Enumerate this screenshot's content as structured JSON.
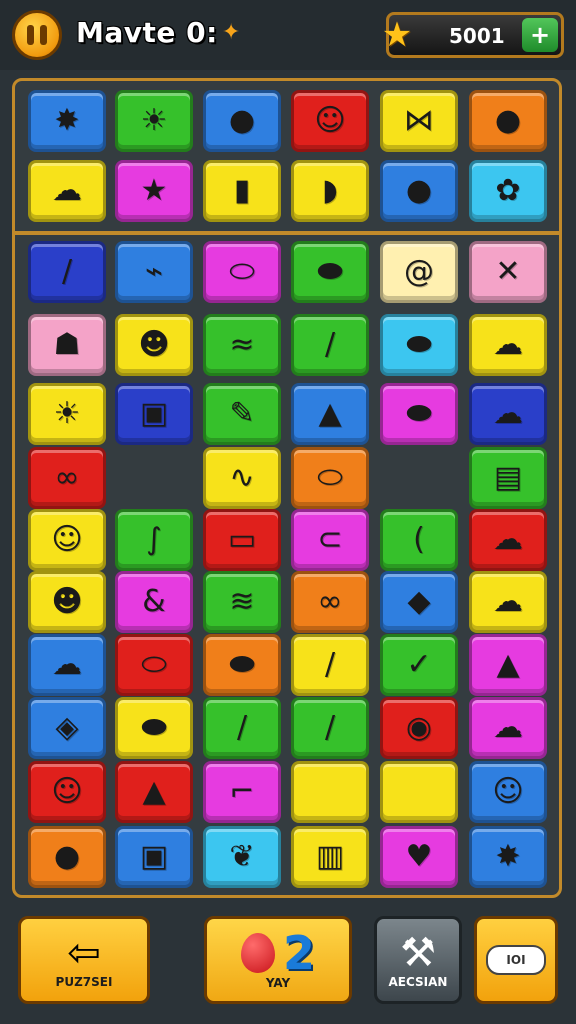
{
  "header": {
    "title": "Mavte 0:",
    "score": "5001",
    "add_symbol": "+"
  },
  "board": {
    "colors": {
      "blue": "#2f7fe0",
      "green": "#36c12b",
      "red": "#e0201c",
      "yellow": "#f7e21a",
      "orange": "#f07f1a",
      "magenta": "#e63be0",
      "navy": "#2a3fc9",
      "cyan": "#3cc6f0",
      "pink": "#f4a3c8",
      "lightyellow": "#fff0b0"
    },
    "rows": [
      [
        {
          "c": "blue",
          "i": "badge-icon",
          "g": "✸"
        },
        {
          "c": "green",
          "i": "sun-icon",
          "g": "☀"
        },
        {
          "c": "blue",
          "i": "apple-icon",
          "g": "●"
        },
        {
          "c": "red",
          "i": "bear-face-icon",
          "g": "☺"
        },
        {
          "c": "yellow",
          "i": "bow-icon",
          "g": "⋈"
        },
        {
          "c": "orange",
          "i": "drop-icon",
          "g": "●"
        }
      ],
      [
        {
          "c": "yellow",
          "i": "cookie-icon",
          "g": "☁"
        },
        {
          "c": "magenta",
          "i": "star-face-icon",
          "g": "★"
        },
        {
          "c": "yellow",
          "i": "bottle-icon",
          "g": "▮"
        },
        {
          "c": "yellow",
          "i": "boat-icon",
          "g": "◗"
        },
        {
          "c": "blue",
          "i": "creature-icon",
          "g": "●"
        },
        {
          "c": "cyan",
          "i": "berry-icon",
          "g": "✿"
        }
      ],
      [
        {
          "c": "navy",
          "i": "stick-icon",
          "g": "/"
        },
        {
          "c": "blue",
          "i": "carrot-icon",
          "g": "⌁"
        },
        {
          "c": "magenta",
          "i": "bean-icon",
          "g": "⬭"
        },
        {
          "c": "green",
          "i": "eggplant-icon",
          "g": "⬬"
        },
        {
          "c": "lightyellow",
          "i": "shrimp-icon",
          "g": "@"
        },
        {
          "c": "pink",
          "i": "tools-icon",
          "g": "✕"
        }
      ],
      [
        {
          "c": "pink",
          "i": "bottle-blue-icon",
          "g": "☗"
        },
        {
          "c": "yellow",
          "i": "chick-icon",
          "g": "☻"
        },
        {
          "c": "green",
          "i": "bacon-icon",
          "g": "≈"
        },
        {
          "c": "green",
          "i": "knife-icon",
          "g": "/"
        },
        {
          "c": "cyan",
          "i": "bun-icon",
          "g": "⬬"
        },
        {
          "c": "yellow",
          "i": "cloud-icon",
          "g": "☁"
        }
      ],
      [
        {
          "c": "yellow",
          "i": "sun-face-icon",
          "g": "☀"
        },
        {
          "c": "navy",
          "i": "bag-icon",
          "g": "▣"
        },
        {
          "c": "green",
          "i": "pen-icon",
          "g": "✎"
        },
        {
          "c": "blue",
          "i": "mountain-icon",
          "g": "▲"
        },
        {
          "c": "magenta",
          "i": "cushion-icon",
          "g": "⬬"
        },
        {
          "c": "navy",
          "i": "cookie-icon",
          "g": "☁"
        }
      ],
      [
        {
          "c": "red",
          "i": "knot-icon",
          "g": "∞"
        },
        null,
        {
          "c": "yellow",
          "i": "squiggle-icon",
          "g": "∿"
        },
        {
          "c": "orange",
          "i": "capsule-icon",
          "g": "⬭"
        },
        null,
        {
          "c": "green",
          "i": "radio-icon",
          "g": "▤"
        }
      ],
      [
        {
          "c": "yellow",
          "i": "smile-icon",
          "g": "☺"
        },
        {
          "c": "green",
          "i": "worm-icon",
          "g": "∫"
        },
        {
          "c": "red",
          "i": "biscuit-icon",
          "g": "▭"
        },
        {
          "c": "magenta",
          "i": "clip-icon",
          "g": "⊂"
        },
        {
          "c": "green",
          "i": "leaf-icon",
          "g": "("
        },
        {
          "c": "red",
          "i": "cloud-icon",
          "g": "☁"
        }
      ],
      [
        {
          "c": "yellow",
          "i": "face-icon",
          "g": "☻"
        },
        {
          "c": "magenta",
          "i": "pretzel-icon",
          "g": "&"
        },
        {
          "c": "green",
          "i": "zigzag-icon",
          "g": "≋"
        },
        {
          "c": "orange",
          "i": "knot-icon",
          "g": "∞"
        },
        {
          "c": "blue",
          "i": "fish-icon",
          "g": "◆"
        },
        {
          "c": "yellow",
          "i": "cloud-icon",
          "g": "☁"
        }
      ],
      [
        {
          "c": "blue",
          "i": "cookie-icon",
          "g": "☁"
        },
        {
          "c": "red",
          "i": "pill-icon",
          "g": "⬭"
        },
        {
          "c": "orange",
          "i": "sausage-icon",
          "g": "⬬"
        },
        {
          "c": "yellow",
          "i": "stick-icon",
          "g": "/"
        },
        {
          "c": "green",
          "i": "check-icon",
          "g": "✓"
        },
        {
          "c": "magenta",
          "i": "tree-icon",
          "g": "▲"
        }
      ],
      [
        {
          "c": "blue",
          "i": "cake-icon",
          "g": "◈"
        },
        {
          "c": "yellow",
          "i": "pepper-icon",
          "g": "⬬"
        },
        {
          "c": "green",
          "i": "blade-icon",
          "g": "/"
        },
        {
          "c": "green",
          "i": "pen-icon",
          "g": "/"
        },
        {
          "c": "red",
          "i": "garlic-icon",
          "g": "◉"
        },
        {
          "c": "magenta",
          "i": "rice-icon",
          "g": "☁"
        }
      ],
      [
        {
          "c": "red",
          "i": "orange-face-icon",
          "g": "☺"
        },
        {
          "c": "red",
          "i": "triangle-icon",
          "g": "▲"
        },
        {
          "c": "magenta",
          "i": "boot-icon",
          "g": "⌐"
        },
        {
          "c": "yellow",
          "i": "empty",
          "g": ""
        },
        {
          "c": "yellow",
          "i": "empty",
          "g": ""
        },
        {
          "c": "blue",
          "i": "bun-face-icon",
          "g": "☺"
        }
      ],
      [
        {
          "c": "orange",
          "i": "blob-icon",
          "g": "●"
        },
        {
          "c": "blue",
          "i": "bag-icon",
          "g": "▣"
        },
        {
          "c": "cyan",
          "i": "leaves-icon",
          "g": "❦"
        },
        {
          "c": "yellow",
          "i": "roll-icon",
          "g": "▥"
        },
        {
          "c": "magenta",
          "i": "heart-icon",
          "g": "♥"
        },
        {
          "c": "blue",
          "i": "sun-face-icon",
          "g": "✸"
        }
      ]
    ]
  },
  "footer": {
    "back_label": "PUZ7SEI",
    "mid_number": "2",
    "mid_label": "YAY",
    "gray_label": "AECSIAN",
    "right_pill": "IOI"
  }
}
